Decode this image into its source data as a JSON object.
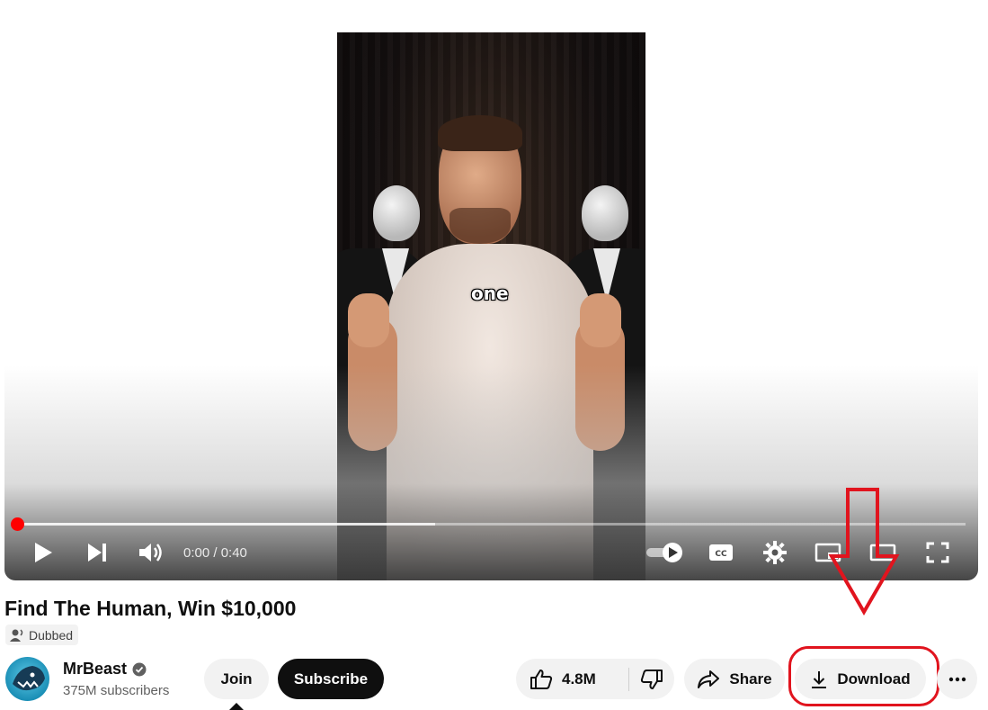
{
  "video": {
    "caption": "one",
    "time_display": "0:00 / 0:40",
    "progress_played_fraction": 0.0,
    "progress_buffered_fraction": 0.44
  },
  "video_info": {
    "title": "Find The Human, Win $10,000",
    "dubbed_badge": "Dubbed"
  },
  "channel": {
    "name": "MrBeast",
    "subscribers": "375M subscribers",
    "join_label": "Join",
    "subscribe_label": "Subscribe"
  },
  "actions": {
    "like_count": "4.8M",
    "share_label": "Share",
    "download_label": "Download"
  },
  "colors": {
    "progress_accent": "#ff0000",
    "highlight_annotation": "#e1141e",
    "subscribe_bg": "#0f0f0f",
    "pill_bg": "#f2f2f2"
  },
  "icons": [
    "play-icon",
    "next-icon",
    "volume-icon",
    "autoplay-toggle-icon",
    "captions-icon",
    "settings-icon",
    "miniplayer-icon",
    "theater-mode-icon",
    "fullscreen-icon",
    "dubbed-icon",
    "verified-icon",
    "like-icon",
    "dislike-icon",
    "share-icon",
    "download-icon",
    "more-options-icon",
    "annotation-arrow-icon"
  ]
}
